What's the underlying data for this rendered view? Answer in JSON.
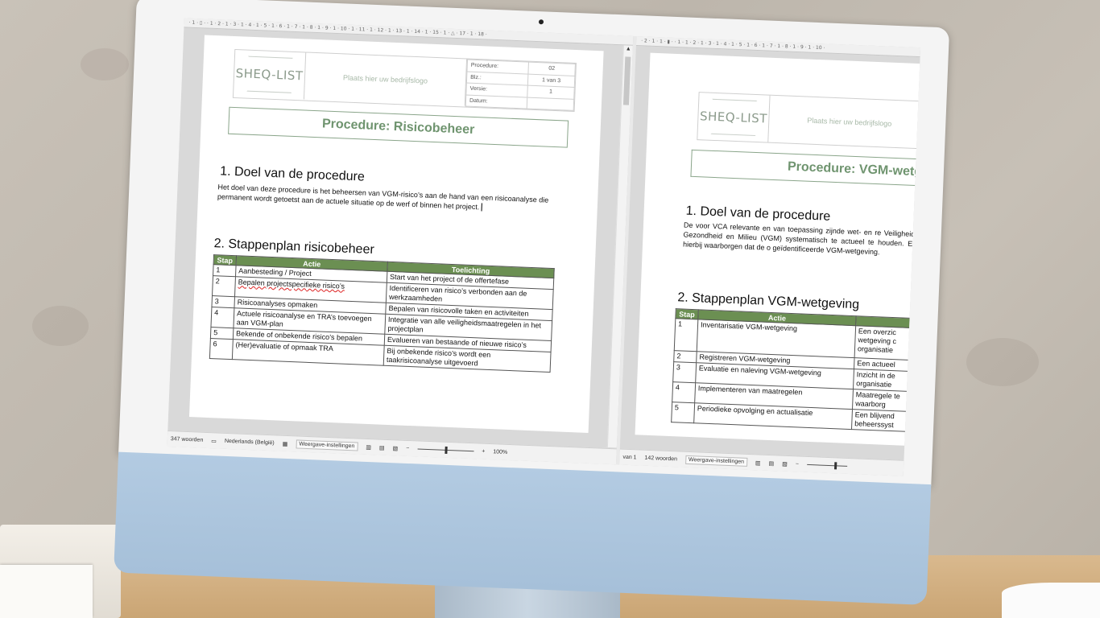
{
  "left_doc": {
    "ruler_text": "· 1 · ▯ · · 1 · 2 · 1 · 3 · 1 · 4 · 1 · 5 · 1 · 6 · 1 · 7 · 1 · 8 · 1 · 9 · 1 · 10 · 1 · 11 · 1 · 12 · 1 · 13 · 1 · 14 · 1 · 15 · 1 · △ · 17 · 1 · 18 ·",
    "logo": "SHEQ-LIST",
    "company_placeholder": "Plaats hier uw bedrijfslogo",
    "meta": [
      {
        "key": "Procedure:",
        "value": "02"
      },
      {
        "key": "Blz.:",
        "value": "1 van 3"
      },
      {
        "key": "Versie:",
        "value": "1"
      },
      {
        "key": "Datum:",
        "value": ""
      }
    ],
    "title": "Procedure: Risicobeheer",
    "section1_heading": "1. Doel van de procedure",
    "section1_text": "Het doel van deze procedure is het beheersen van VGM-risico’s aan de hand van een risicoanalyse die permanent wordt getoetst aan de actuele situatie op de werf of binnen het project.",
    "section2_heading": "2. Stappenplan risicobeheer",
    "table_headers": {
      "stap": "Stap",
      "actie": "Actie",
      "toelichting": "Toelichting"
    },
    "rows": [
      {
        "stap": "1",
        "actie": "Aanbesteding / Project",
        "toelichting": "Start van het project of de offertefase"
      },
      {
        "stap": "2",
        "actie": "Bepalen projectspecifieke risico’s",
        "toelichting": "Identificeren van risico’s verbonden aan de werkzaamheden"
      },
      {
        "stap": "3",
        "actie": "Risicoanalyses opmaken",
        "toelichting": "Bepalen van risicovolle taken en activiteiten"
      },
      {
        "stap": "4",
        "actie": "Actuele risicoanalyse en TRA’s toevoegen aan VGM-plan",
        "toelichting": "Integratie van alle veiligheidsmaatregelen in het projectplan"
      },
      {
        "stap": "5",
        "actie": "Bekende of onbekende risico’s bepalen",
        "toelichting": "Evalueren van bestaande of nieuwe risico’s"
      },
      {
        "stap": "6",
        "actie": "(Her)evaluatie of opmaak TRA",
        "toelichting": "Bij onbekende risico’s wordt een taakrisicoanalyse uitgevoerd"
      }
    ],
    "status": {
      "words": "347 woorden",
      "language": "Nederlands (België)",
      "display_settings": "Weergave-instellingen",
      "zoom": "100%"
    }
  },
  "right_doc": {
    "ruler_text": "· 2 · 1 · 1 · ▮ · · 1 · 1 · 2 · 1 · 3 · 1 · 4 · 1 · 5 · 1 · 6 · 1 · 7 · 1 · 8 · 1 · 9 · 1 · 10 ·",
    "logo": "SHEQ-LIST",
    "company_placeholder": "Plaats hier uw bedrijfslogo",
    "title": "Procedure: VGM-wetge",
    "section1_heading": "1. Doel van de procedure",
    "section1_text": "De voor VCA relevante en van toepassing zijnde wet- en re Veiligheid, Gezondheid en Milieu (VGM) systematisch te actueel te houden. En hierbij waarborgen dat de o geïdentificeerde VGM-wetgeving.",
    "section2_heading": "2. Stappenplan VGM-wetgeving",
    "table_headers": {
      "stap": "Stap",
      "actie": "Actie"
    },
    "rows": [
      {
        "stap": "1",
        "actie": "Inventarisatie VGM-wetgeving",
        "toelichting": "Een overzic wetgeving c organisatie"
      },
      {
        "stap": "2",
        "actie": "Registreren VGM-wetgeving",
        "toelichting": "Een actueel"
      },
      {
        "stap": "3",
        "actie": "Evaluatie en naleving VGM-wetgeving",
        "toelichting": "Inzicht in de organisatie"
      },
      {
        "stap": "4",
        "actie": "Implementeren van maatregelen",
        "toelichting": "Maatregele te waarborg"
      },
      {
        "stap": "5",
        "actie": "Periodieke opvolging en actualisatie",
        "toelichting": "Een blijvend beheerssyst"
      }
    ],
    "status": {
      "page": "van 1",
      "words": "142 woorden",
      "display_settings": "Weergave-instellingen"
    }
  },
  "colors": {
    "accent_green": "#6f946f",
    "table_header": "#6b8f52",
    "monitor_chin": "#a6c0d9"
  }
}
